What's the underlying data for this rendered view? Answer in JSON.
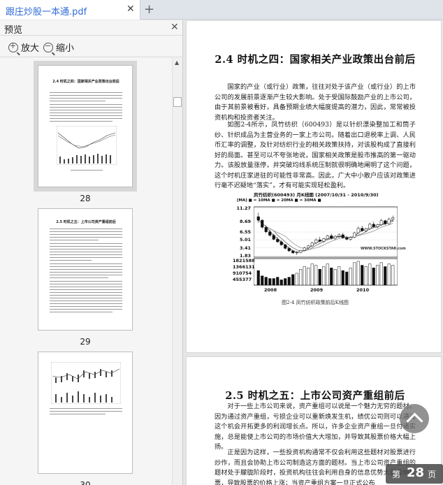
{
  "tab": {
    "title": "跟庄炒股一本通.pdf",
    "close_icon": "close-icon",
    "add_icon": "plus-icon"
  },
  "sidebar": {
    "title": "预览",
    "zoom_in": "放大",
    "zoom_out": "缩小",
    "thumbnails": [
      {
        "page": "28",
        "title": "2.4  时机之四：国家相关产业政策出台前后"
      },
      {
        "page": "29",
        "title": "2.5  时机之五：上市公司资产重组前后"
      },
      {
        "page": "30",
        "title": ""
      }
    ]
  },
  "doc": {
    "section1_title": "2.4   时机之四：国家相关产业政策出台前后",
    "section1_p1": "国家的产业（或行业）政策，往往对处于该产业（或行业）的上市公司的发展前景逐渐产生较大影响。处于受国际鼓励产业的上市公司，由于其前景被看好，具备预期业绩大幅度提高的潜力，因此，常常被投资机构和投资者关注。",
    "section1_p2": "如图2-4所示，凤竹纺织（600493）是以针织漂染整加工和筒子纱、针织成品为主营业务的一家上市公司。随着出口退税率上调、人民币汇率的调整，及针对纺织行业的相关政策扶持，对该股构成了直接利好的局面。甚至可以不夸张地说，国家相关政策是股市推高的第一驱动力。该股放量涨停，并突破均线系统压制就很明确地阐明了这个问题，这个时机庄家进驻的可能性非常高。因此，广大中小散户应该对政策进行毫不迟疑地“落实”，才有可能实现轻松盈利。",
    "figure_caption": "图2-4    凤竹纺织政策前后K线图",
    "section2_title": "2.5   时机之五：上市公司资产重组前后",
    "section2_p1": "对于一些上市公司来说，资产重组可以说是一个魅力无穷的题材。因为通过资产重组，亏损企业可以重新焕发生机，绩优公司则可以通过这个机会开拓更多的利润增长点。所以，许多企业资产重组一旦付诸实施，总是能使上市公司的市场价值大大增加，并导致其股票价格大幅上扬。",
    "section2_p2": "正是因为这样，一些投资机构通常不仅会利用这些题材对股票进行炒作，而且会协助上市公司制造这方面的题材。当上市公司资产重组的题材处于朦胧阶段时，投资机构往往会利用自身的信息优势大量吸纳股票，导致股票的价格上涨；当资产重组方案一旦正式公布"
  },
  "chart_data": {
    "type": "candlestick",
    "title": "凤竹纺织(600493) 月K线图 (2007/10/31 - 2010/9/30)",
    "legend": "[MA] ■ = 10MA ■ = 20MA ■ = 30MA ■",
    "price_ticks": [
      "11.27",
      "8.69",
      "6.55",
      "5.01",
      "3.41",
      "1.83"
    ],
    "volume_ticks": [
      "1821588",
      "1366131",
      "910754",
      "455377"
    ],
    "x_ticks": [
      "2008",
      "2009",
      "2010"
    ],
    "watermark": "WWW.STOCKSTAR.com",
    "price_ylim": [
      1.83,
      11.27
    ],
    "candles": [
      [
        9.6,
        10.4,
        8.4,
        8.9
      ],
      [
        8.9,
        9.1,
        7.2,
        7.5
      ],
      [
        7.5,
        7.9,
        6.3,
        6.6
      ],
      [
        6.6,
        7.0,
        5.6,
        5.9
      ],
      [
        5.9,
        6.2,
        4.9,
        5.1
      ],
      [
        5.1,
        5.5,
        4.4,
        4.6
      ],
      [
        4.6,
        4.9,
        3.8,
        4.0
      ],
      [
        4.0,
        4.2,
        3.1,
        3.3
      ],
      [
        3.3,
        3.6,
        2.6,
        2.8
      ],
      [
        2.8,
        3.0,
        2.2,
        2.4
      ],
      [
        2.4,
        2.7,
        2.0,
        2.5
      ],
      [
        2.5,
        3.0,
        2.3,
        2.9
      ],
      [
        2.9,
        3.6,
        2.8,
        3.4
      ],
      [
        3.4,
        4.0,
        3.2,
        3.8
      ],
      [
        3.8,
        4.6,
        3.6,
        4.4
      ],
      [
        4.4,
        5.3,
        4.2,
        5.0
      ],
      [
        5.0,
        5.6,
        4.5,
        4.7
      ],
      [
        4.7,
        5.4,
        4.5,
        5.2
      ],
      [
        5.2,
        6.0,
        5.0,
        5.8
      ],
      [
        5.8,
        6.2,
        5.1,
        5.3
      ],
      [
        5.3,
        5.9,
        5.0,
        5.7
      ],
      [
        5.7,
        6.3,
        5.4,
        6.0
      ],
      [
        6.0,
        6.4,
        5.2,
        5.4
      ],
      [
        5.4,
        5.8,
        4.9,
        5.1
      ],
      [
        5.1,
        5.7,
        4.8,
        5.5
      ],
      [
        5.5,
        6.6,
        5.3,
        6.4
      ],
      [
        6.4,
        7.6,
        6.2,
        7.3
      ],
      [
        7.3,
        7.8,
        6.6,
        6.8
      ],
      [
        6.8,
        7.4,
        6.5,
        7.2
      ],
      [
        7.2,
        8.4,
        7.0,
        8.1
      ],
      [
        8.1,
        8.6,
        7.4,
        7.6
      ],
      [
        7.6,
        8.2,
        7.3,
        8.0
      ],
      [
        8.0,
        9.2,
        7.8,
        8.8
      ],
      [
        8.8,
        9.0,
        7.9,
        8.2
      ],
      [
        8.2,
        9.4,
        8.0,
        9.1
      ],
      [
        9.1,
        9.8,
        8.6,
        9.4
      ]
    ],
    "volumes": [
      1.1,
      0.7,
      0.6,
      0.5,
      0.5,
      0.6,
      0.4,
      0.5,
      0.6,
      0.8,
      0.9,
      1.2,
      1.4,
      1.3,
      1.6,
      1.5,
      1.2,
      1.4,
      1.6,
      1.3,
      1.2,
      1.4,
      1.1,
      1.0,
      1.3,
      1.7,
      1.8,
      1.5,
      1.4,
      1.6,
      1.3,
      1.5,
      1.7,
      1.4,
      1.6,
      1.5
    ],
    "volume_ylim": [
      0,
      1.9
    ]
  },
  "page_indicator": {
    "prefix": "第",
    "number": "28",
    "suffix": "页"
  }
}
